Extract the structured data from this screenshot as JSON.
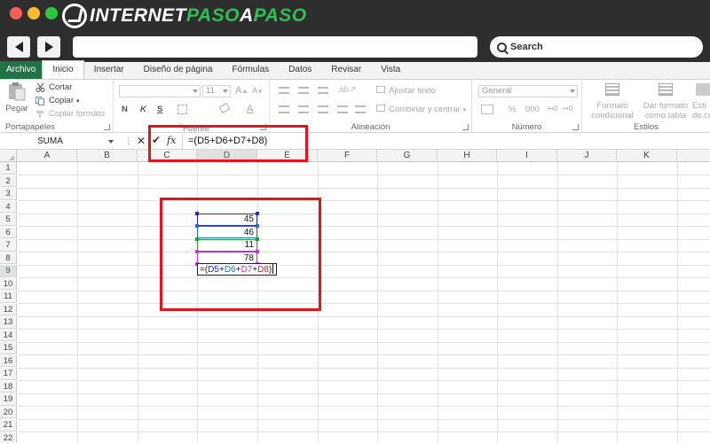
{
  "brand": {
    "part1": "INTERNET",
    "part2": "PASO",
    "part3": "A",
    "part4": "PASO"
  },
  "browser": {
    "search_label": "Search"
  },
  "ribbon_tabs": [
    "Archivo",
    "Inicio",
    "Insertar",
    "Diseño de página",
    "Fórmulas",
    "Datos",
    "Revisar",
    "Vista"
  ],
  "active_tab": "Inicio",
  "clipboard": {
    "paste": "Pegar",
    "cut": "Cortar",
    "copy": "Copiar",
    "format_painter": "Copiar formato",
    "group": "Portapapeles"
  },
  "font": {
    "size": "11",
    "bold": "N",
    "italic": "K",
    "underline": "S",
    "grow": "A",
    "shrink": "A",
    "color": "A",
    "group": "Fuente"
  },
  "alignment": {
    "wrap": "Ajustar texto",
    "merge": "Combinar y centrar",
    "group": "Alineación"
  },
  "number": {
    "format": "General",
    "percent": "%",
    "comma": "000",
    "group": "Número"
  },
  "styles": {
    "conditional": "Formato condicional",
    "as_table": "Dar formato como tabla",
    "cell_styles": "Esti de ce",
    "group": "Estilos"
  },
  "formula_bar": {
    "name_box": "SUMA",
    "cancel": "✕",
    "enter": "✔",
    "fx": "fx",
    "formula": "=(D5+D6+D7+D8)"
  },
  "columns": [
    "A",
    "B",
    "C",
    "D",
    "E",
    "F",
    "G",
    "H",
    "I",
    "J",
    "K"
  ],
  "selected_column": "D",
  "rows": [
    "1",
    "2",
    "3",
    "4",
    "5",
    "6",
    "7",
    "8",
    "9",
    "10",
    "11",
    "12",
    "13",
    "14",
    "15",
    "16",
    "17",
    "18",
    "19",
    "20",
    "21",
    "22"
  ],
  "selected_row": "9",
  "cells": {
    "D5": "45",
    "D6": "46",
    "D7": "11",
    "D8": "78"
  },
  "edit_cell": {
    "prefix": "=(",
    "r1": "D5",
    "p1": "+",
    "r2": "D6",
    "p2": "+",
    "r3": "D7",
    "p3": "+",
    "r4": "D8",
    "suffix": ")"
  },
  "ref_colors": {
    "D5": "#1f2ec9",
    "D6": "#1a6fd6",
    "D7": "#1f9e3a",
    "D8": "#c23ad0",
    "D8_text": "#b0303a"
  },
  "colors": {
    "excel_green": "#217346",
    "highlight_red": "#e0151d"
  }
}
